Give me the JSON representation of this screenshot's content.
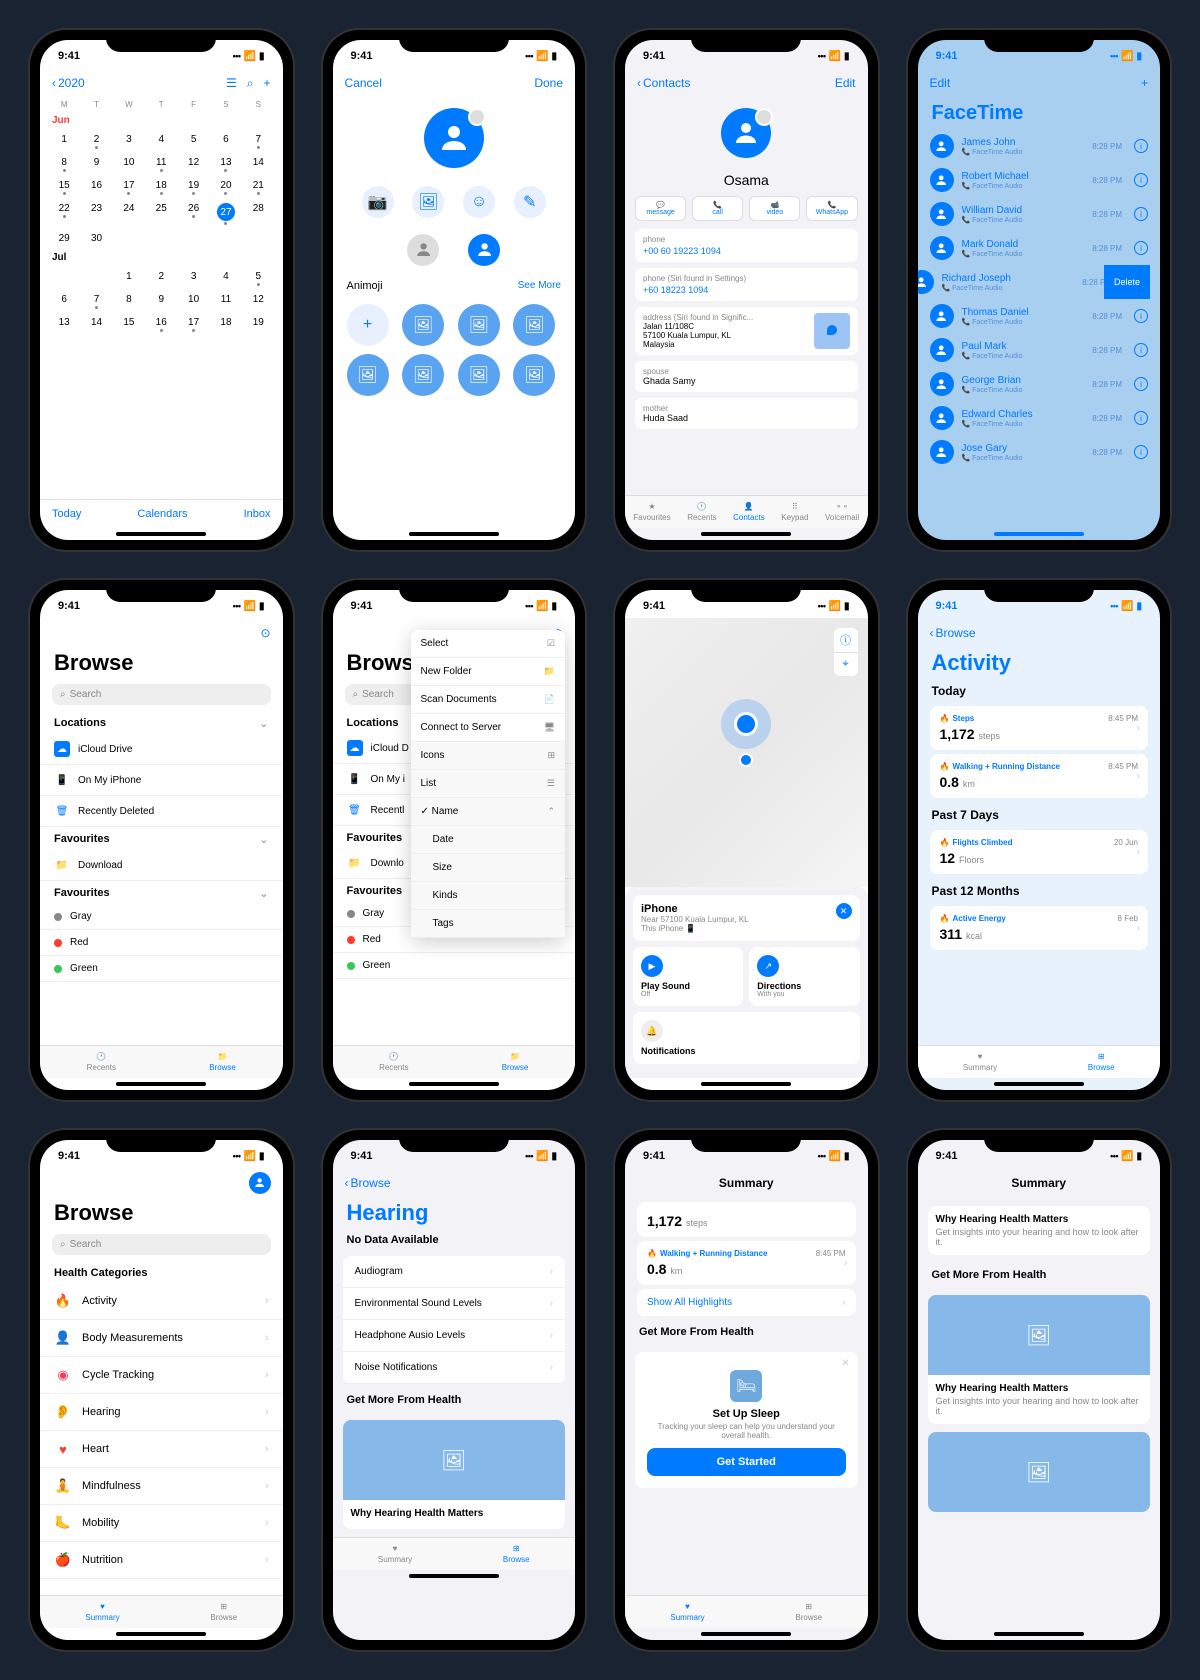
{
  "time": "9:41",
  "calendar": {
    "back": "2020",
    "months": [
      {
        "name": "Jun",
        "days": [
          [
            "1",
            "2",
            "3",
            "4",
            "5",
            "6",
            "7"
          ],
          [
            "8",
            "9",
            "10",
            "11",
            "12",
            "13",
            "14"
          ],
          [
            "15",
            "16",
            "17",
            "18",
            "19",
            "20",
            "21"
          ],
          [
            "22",
            "23",
            "24",
            "25",
            "26",
            "27",
            "28"
          ],
          [
            "29",
            "30",
            "",
            "",
            "",
            "",
            ""
          ]
        ],
        "today": "27"
      },
      {
        "name": "Jul",
        "days": [
          [
            "",
            "",
            "1",
            "2",
            "3",
            "4",
            "5"
          ],
          [
            "6",
            "7",
            "8",
            "9",
            "10",
            "11",
            "12"
          ],
          [
            "13",
            "14",
            "15",
            "16",
            "17",
            "18",
            "19"
          ]
        ]
      }
    ],
    "dow": [
      "M",
      "T",
      "W",
      "T",
      "F",
      "S",
      "S"
    ],
    "footer": {
      "today": "Today",
      "calendars": "Calendars",
      "inbox": "Inbox"
    }
  },
  "avatar_edit": {
    "cancel": "Cancel",
    "done": "Done",
    "section": "Animoji",
    "more": "See More"
  },
  "contact": {
    "back": "Contacts",
    "edit": "Edit",
    "name": "Osama",
    "actions": [
      "message",
      "call",
      "video",
      "WhatsApp"
    ],
    "phone_label": "phone",
    "phone": "+00 60 19223 1094",
    "phone2_label": "phone (Siri found in Settings)",
    "phone2": "+60 18223 1094",
    "addr_label": "address (Siri found in Signific...",
    "addr": "Jalan 11/108C\n57100 Kuala Lumpur, KL\nMalaysia",
    "spouse_label": "spouse",
    "spouse": "Ghada Samy",
    "mother_label": "mother",
    "mother": "Huda Saad",
    "tabs": [
      "Favourites",
      "Recents",
      "Contacts",
      "Keypad",
      "Voicemail"
    ]
  },
  "facetime": {
    "edit": "Edit",
    "title": "FaceTime",
    "sub": "FaceTime Audio",
    "time": "8:28 PM",
    "delete": "Delete",
    "items": [
      "James John",
      "Robert Michael",
      "William David",
      "Mark Donald",
      "Richard Joseph",
      "Thomas Daniel",
      "Paul Mark",
      "George Brian",
      "Edward Charles",
      "Jose Gary"
    ]
  },
  "files": {
    "title": "Browse",
    "search": "Search",
    "locations": "Locations",
    "items": [
      "iCloud Drive",
      "On My iPhone",
      "Recently Deleted"
    ],
    "favourites": "Favourites",
    "fav_items": [
      "Download"
    ],
    "tags": "Favourites",
    "tag_items": [
      {
        "c": "#888",
        "n": "Gray"
      },
      {
        "c": "#ff3b30",
        "n": "Red"
      },
      {
        "c": "#34c759",
        "n": "Green"
      }
    ],
    "tabs": [
      "Recents",
      "Browse"
    ],
    "menu": [
      "Select",
      "New Folder",
      "Scan Documents",
      "Connect to Server"
    ],
    "view": [
      "Icons",
      "List"
    ],
    "sort": [
      "Name",
      "Date",
      "Size",
      "Kinds",
      "Tags"
    ]
  },
  "findmy": {
    "device": "iPhone",
    "loc": "Near 57100 Kuala Lumpur, KL",
    "sub": "This iPhone",
    "play": "Play Sound",
    "play_sub": "Off",
    "dir": "Directions",
    "dir_sub": "With you",
    "notif": "Notifications",
    "nav_icons": [
      "i",
      "loc"
    ]
  },
  "activity": {
    "back": "Browse",
    "title": "Activity",
    "today": "Today",
    "past7": "Past 7 Days",
    "past12": "Past 12 Months",
    "cards": [
      {
        "icon": "🔥",
        "label": "Steps",
        "time": "8:45 PM",
        "val": "1,172",
        "unit": "steps"
      },
      {
        "icon": "🔥",
        "label": "Walking + Running Distance",
        "time": "8:45 PM",
        "val": "0.8",
        "unit": "km"
      },
      {
        "icon": "🔥",
        "label": "Flights Climbed",
        "time": "20 Jun",
        "val": "12",
        "unit": "Floors"
      },
      {
        "icon": "🔥",
        "label": "Active Energy",
        "time": "8 Feb",
        "val": "311",
        "unit": "kcal"
      }
    ],
    "tabs": [
      "Summary",
      "Browse"
    ]
  },
  "health_browse": {
    "title": "Browse",
    "search": "Search",
    "categories": "Health Categories",
    "items": [
      {
        "c": "#ff6b35",
        "n": "Activity"
      },
      {
        "c": "#af52de",
        "n": "Body Measurements"
      },
      {
        "c": "#ff375f",
        "n": "Cycle Tracking"
      },
      {
        "c": "#007aff",
        "n": "Hearing"
      },
      {
        "c": "#ff3b30",
        "n": "Heart"
      },
      {
        "c": "#5ac8fa",
        "n": "Mindfulness"
      },
      {
        "c": "#ff9500",
        "n": "Mobility"
      },
      {
        "c": "#30d158",
        "n": "Nutrition"
      }
    ],
    "tabs": [
      "Summary",
      "Browse"
    ]
  },
  "hearing": {
    "back": "Browse",
    "title": "Hearing",
    "nodata": "No Data Available",
    "items": [
      "Audiogram",
      "Environmental Sound Levels",
      "Headphone Ausio Levels",
      "Noise Notifications"
    ],
    "more": "Get More From Health",
    "card_title": "Why Hearing Health Matters"
  },
  "summary": {
    "title": "Summary",
    "steps_val": "1,172",
    "steps_unit": "steps",
    "walk_label": "Walking + Running Distance",
    "walk_time": "8:45 PM",
    "walk_val": "0.8",
    "walk_unit": "km",
    "showall": "Show All Highlights",
    "more": "Get More From Health",
    "sleep_title": "Set Up Sleep",
    "sleep_text": "Tracking your sleep can help you understand your overall health.",
    "cta": "Get Started"
  },
  "summary2": {
    "title": "Summary",
    "card_title": "Why Hearing Health Matters",
    "card_text": "Get insights into your hearing and how to look after it.",
    "more": "Get More From Health"
  }
}
